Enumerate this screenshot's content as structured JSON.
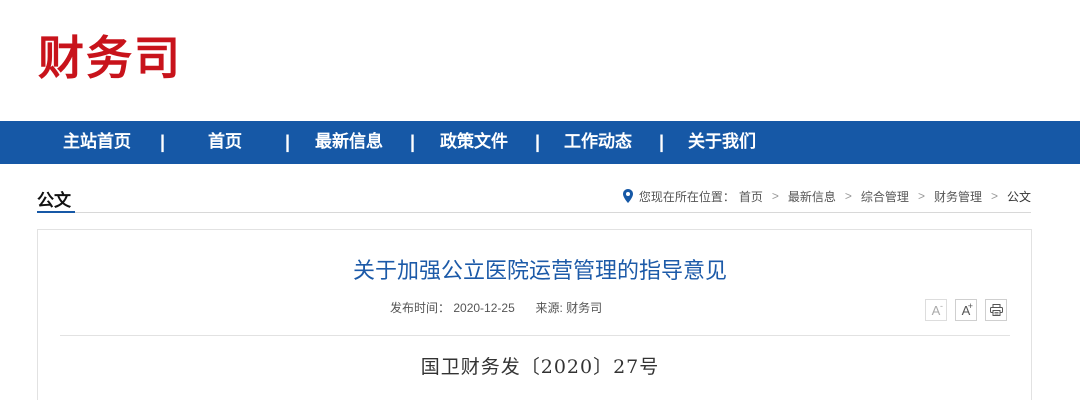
{
  "site": {
    "logo_text": "财务司",
    "brand_color": "#c8131b",
    "nav_color": "#1658a6"
  },
  "nav": {
    "items": [
      {
        "label": "主站首页"
      },
      {
        "label": "首页"
      },
      {
        "label": "最新信息"
      },
      {
        "label": "政策文件"
      },
      {
        "label": "工作动态"
      },
      {
        "label": "关于我们"
      }
    ],
    "separator": "|"
  },
  "section": {
    "title": "公文"
  },
  "breadcrumb": {
    "icon": "location-pin-icon",
    "prefix": "您现在所在位置：",
    "items": [
      "首页",
      "最新信息",
      "综合管理",
      "财务管理",
      "公文"
    ]
  },
  "article": {
    "title": "关于加强公立医院运营管理的指导意见",
    "publish_label": "发布时间：",
    "publish_date": "2020-12-25",
    "source_label": "来源:",
    "source": "财务司",
    "doc_number": "国卫财务发〔2020〕27号"
  },
  "tools": {
    "font_decrease": "A",
    "font_decrease_mark": "-",
    "font_increase": "A",
    "font_increase_mark": "+",
    "print_icon": "printer-icon"
  }
}
